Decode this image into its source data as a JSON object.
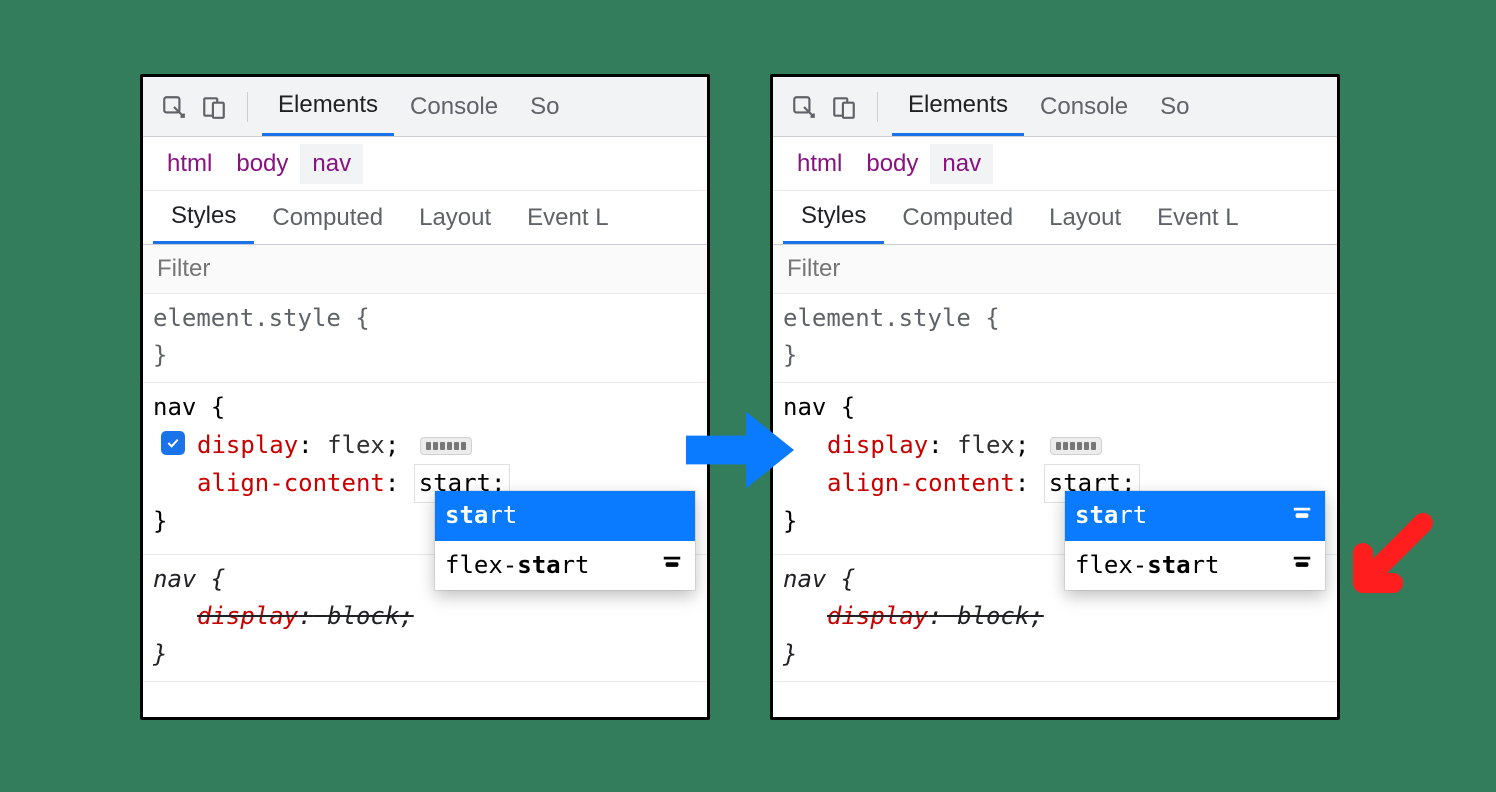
{
  "toolbar": {
    "tabs": {
      "elements": "Elements",
      "console": "Console",
      "sources_trunc": "So"
    }
  },
  "crumbs": {
    "a": "html",
    "b": "body",
    "c": "nav"
  },
  "subtabs": {
    "styles": "Styles",
    "computed": "Computed",
    "layout": "Layout",
    "event_trunc": "Event L"
  },
  "filter": {
    "placeholder": "Filter"
  },
  "rules": {
    "element_style_open": "element.style {",
    "close": "}",
    "nav_open": "nav {",
    "display_prop": "display",
    "display_val": "flex",
    "align_prop": "align-content",
    "align_val_typed": "start",
    "semicolon": ";",
    "colon": ":",
    "nav_ua_open": "nav {",
    "ua_display_prop": "display",
    "ua_display_val": "block"
  },
  "autocomplete": {
    "opt1_pre_bold": "sta",
    "opt1_post": "rt",
    "opt2_pre": "flex-",
    "opt2_bold": "sta",
    "opt2_post": "rt"
  }
}
